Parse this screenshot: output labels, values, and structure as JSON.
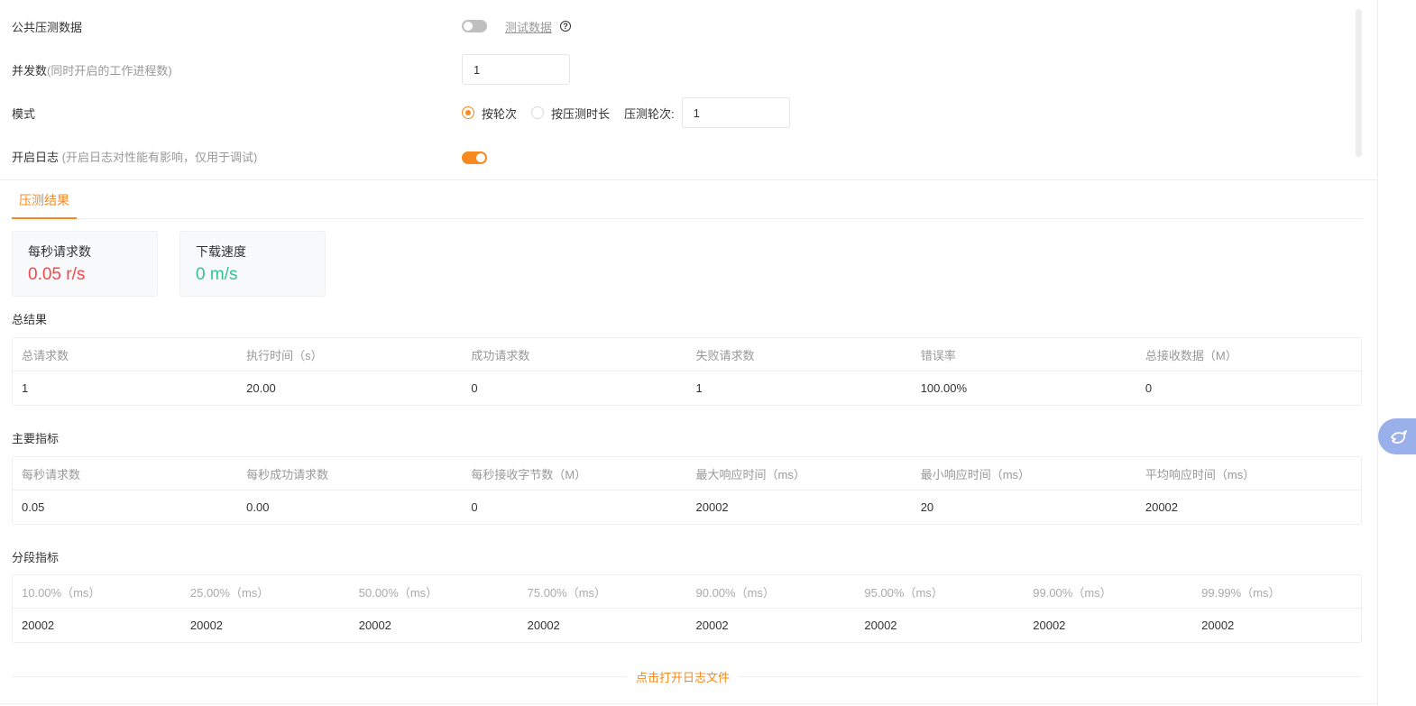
{
  "settings": {
    "public_data": {
      "label": "公共压测数据",
      "enabled": false,
      "link": "测试数据",
      "help": "?"
    },
    "concurrency": {
      "label": "并发数",
      "hint": "(同时开启的工作进程数)",
      "value": "1"
    },
    "mode": {
      "label": "模式",
      "options": [
        "按轮次",
        "按压测时长"
      ],
      "selected": "按轮次",
      "rounds_label": "压测轮次:",
      "rounds_value": "1"
    },
    "log": {
      "label": "开启日志",
      "hint": " (开启日志对性能有影响，仅用于调试)",
      "enabled": true
    }
  },
  "tabs": [
    {
      "label": "压测结果",
      "active": true
    }
  ],
  "cards": {
    "rps": {
      "title": "每秒请求数",
      "value": "0.05 r/s",
      "color": "#f5484a"
    },
    "download": {
      "title": "下载速度",
      "value": "0 m/s",
      "color": "#34c38f"
    }
  },
  "summary": {
    "title": "总结果",
    "headers": [
      "总请求数",
      "执行时间（s）",
      "成功请求数",
      "失败请求数",
      "错误率",
      "总接收数据（M）"
    ],
    "row": [
      "1",
      "20.00",
      "0",
      "1",
      "100.00%",
      "0"
    ]
  },
  "main_metrics": {
    "title": "主要指标",
    "headers": [
      "每秒请求数",
      "每秒成功请求数",
      "每秒接收字节数（M）",
      "最大响应时间（ms）",
      "最小响应时间（ms）",
      "平均响应时间（ms）"
    ],
    "row": [
      "0.05",
      "0.00",
      "0",
      "20002",
      "20",
      "20002"
    ]
  },
  "percentiles": {
    "title": "分段指标",
    "headers": [
      "10.00%（ms）",
      "25.00%（ms）",
      "50.00%（ms）",
      "75.00%（ms）",
      "90.00%（ms）",
      "95.00%（ms）",
      "99.00%（ms）",
      "99.99%（ms）"
    ],
    "row": [
      "20002",
      "20002",
      "20002",
      "20002",
      "20002",
      "20002",
      "20002",
      "20002"
    ]
  },
  "open_log": {
    "label": "点击打开日志文件"
  },
  "accent": "#f7891e"
}
